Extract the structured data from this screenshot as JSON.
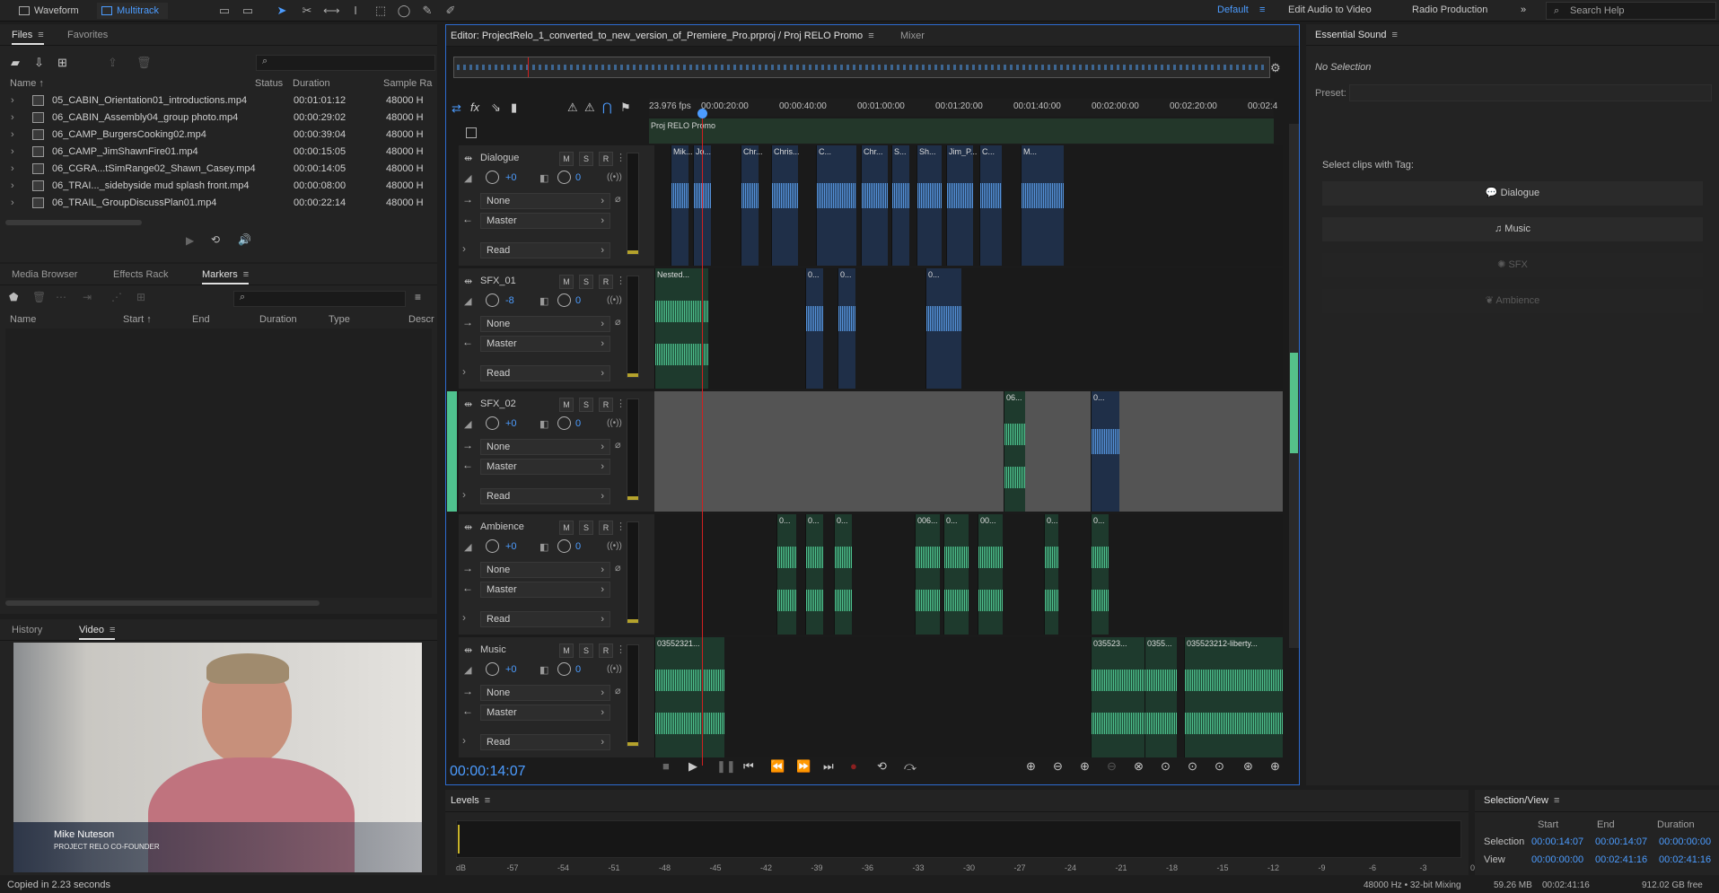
{
  "topbar": {
    "waveform_label": "Waveform",
    "multitrack_label": "Multitrack",
    "workspaces": [
      "Default",
      "Edit Audio to Video",
      "Radio Production"
    ],
    "search_placeholder": "Search Help"
  },
  "files_panel": {
    "tabs": [
      "Files",
      "Favorites"
    ],
    "columns": [
      "Name ↑",
      "Status",
      "Duration",
      "Sample Ra"
    ],
    "files": [
      {
        "name": "05_CABIN_Orientation01_introductions.mp4",
        "duration": "00:01:01:12",
        "rate": "48000 H"
      },
      {
        "name": "06_CABIN_Assembly04_group photo.mp4",
        "duration": "00:00:29:02",
        "rate": "48000 H"
      },
      {
        "name": "06_CAMP_BurgersCooking02.mp4",
        "duration": "00:00:39:04",
        "rate": "48000 H"
      },
      {
        "name": "06_CAMP_JimShawnFire01.mp4",
        "duration": "00:00:15:05",
        "rate": "48000 H"
      },
      {
        "name": "06_CGRA...tSimRange02_Shawn_Casey.mp4",
        "duration": "00:00:14:05",
        "rate": "48000 H"
      },
      {
        "name": "06_TRAI..._sidebyside mud splash front.mp4",
        "duration": "00:00:08:00",
        "rate": "48000 H"
      },
      {
        "name": "06_TRAIL_GroupDiscussPlan01.mp4",
        "duration": "00:00:22:14",
        "rate": "48000 H"
      }
    ]
  },
  "markers_panel": {
    "tabs": [
      "Media Browser",
      "Effects Rack",
      "Markers"
    ],
    "columns": [
      "Name",
      "Start ↑",
      "End",
      "Duration",
      "Type",
      "Descr"
    ]
  },
  "video_panel": {
    "tabs": [
      "History",
      "Video"
    ],
    "lower_third_name": "Mike Nuteson",
    "lower_third_title": "PROJECT RELO CO-FOUNDER"
  },
  "status_left": "Copied in 2.23 seconds",
  "editor": {
    "title": "Editor: ProjectRelo_1_converted_to_new_version_of_Premiere_Pro.prproj / Proj RELO Promo",
    "mixer_tab": "Mixer",
    "fps": "23.976 fps",
    "ruler": [
      "00:00:20:00",
      "00:00:40:00",
      "00:01:00:00",
      "00:01:20:00",
      "00:01:40:00",
      "00:02:00:00",
      "00:02:20:00",
      "00:02:4"
    ],
    "sequence_name": "Proj RELO Promo",
    "timecode": "00:00:14:07",
    "tracks": [
      {
        "name": "Dialogue",
        "volume": "+0",
        "pan": "0",
        "input": "None",
        "output": "Master",
        "mode": "Read"
      },
      {
        "name": "SFX_01",
        "volume": "-8",
        "pan": "0",
        "input": "None",
        "output": "Master",
        "mode": "Read"
      },
      {
        "name": "SFX_02",
        "volume": "+0",
        "pan": "0",
        "input": "None",
        "output": "Master",
        "mode": "Read"
      },
      {
        "name": "Ambience",
        "volume": "+0",
        "pan": "0",
        "input": "None",
        "output": "Master",
        "mode": "Read"
      },
      {
        "name": "Music",
        "volume": "+0",
        "pan": "0",
        "input": "None",
        "output": "Master",
        "mode": "Read"
      }
    ],
    "msr": [
      "M",
      "S",
      "R"
    ],
    "clip_labels": {
      "dialogue": [
        "Mik...",
        "Jo...",
        "Chr...",
        "Chris...",
        "C...",
        "Chr...",
        "S...",
        "Sh...",
        "Jim_P...",
        "C...",
        "M..."
      ],
      "sfx01": [
        "Nested...",
        "0...",
        "0...",
        "0..."
      ],
      "sfx02": [
        "06...",
        "0..."
      ],
      "ambience": [
        "0...",
        "0...",
        "0...",
        "006...",
        "0...",
        "00...",
        "0...",
        "0..."
      ],
      "music": [
        "03552321...",
        "035523...",
        "0355...",
        "035523212-liberty..."
      ]
    }
  },
  "essential_sound": {
    "title": "Essential Sound",
    "no_selection": "No Selection",
    "preset_label": "Preset:",
    "select_label": "Select clips with Tag:",
    "buttons": [
      "Dialogue",
      "Music",
      "SFX",
      "Ambience"
    ]
  },
  "levels": {
    "title": "Levels",
    "ticks": [
      "dB",
      "-57",
      "-54",
      "-51",
      "-48",
      "-45",
      "-42",
      "-39",
      "-36",
      "-33",
      "-30",
      "-27",
      "-24",
      "-21",
      "-18",
      "-15",
      "-12",
      "-9",
      "-6",
      "-3",
      "0"
    ]
  },
  "selection_view": {
    "title": "Selection/View",
    "columns": [
      "Start",
      "End",
      "Duration"
    ],
    "selection_label": "Selection",
    "selection": [
      "00:00:14:07",
      "00:00:14:07",
      "00:00:00:00"
    ],
    "view_label": "View",
    "view": [
      "00:00:00:00",
      "00:02:41:16",
      "00:02:41:16"
    ]
  },
  "status_right": {
    "format": "48000 Hz • 32-bit Mixing",
    "memory": "59.26 MB",
    "duration": "00:02:41:16",
    "disk": "912.02 GB free"
  },
  "colors": {
    "accent": "#4c9cff",
    "dialogue_wave": "#5b9dea",
    "music_wave": "#4fc28f",
    "playhead": "#d02020",
    "selected_track": "#4fc28f"
  }
}
